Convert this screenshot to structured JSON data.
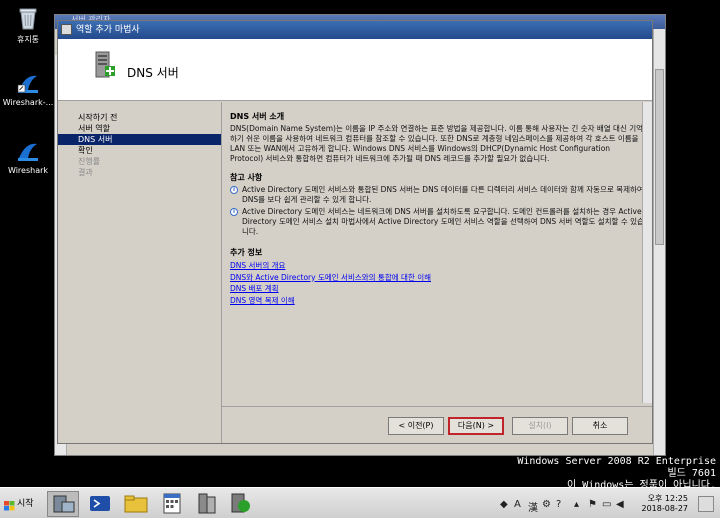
{
  "desktop": {
    "icons": [
      {
        "label": "휴지통"
      },
      {
        "label": "Wireshark-..."
      },
      {
        "label": "Wireshark"
      }
    ],
    "watermark": {
      "line1": "Windows Server 2008 R2 Enterprise",
      "line2": "빌드 7601",
      "line3": "이 Windows는 정품이 아닙니다."
    }
  },
  "background_window": {
    "title": "서버 관리자"
  },
  "wizard": {
    "title": "역할 추가 마법사",
    "header_title": "DNS 서버",
    "nav": [
      {
        "label": "시작하기 전",
        "state": "normal"
      },
      {
        "label": "서버 역할",
        "state": "normal"
      },
      {
        "label": "DNS 서버",
        "state": "selected"
      },
      {
        "label": "확인",
        "state": "normal"
      },
      {
        "label": "진행률",
        "state": "dim"
      },
      {
        "label": "결과",
        "state": "dim"
      }
    ],
    "intro": {
      "title": "DNS 서버 소개",
      "text": "DNS(Domain Name System)는 이름을 IP 주소와 연결하는 표준 방법을 제공합니다. 이름 통해 사용자는 긴 숫자 배열 대신 기억하기 쉬운 이름을 사용하여 네트워크 컴퓨터를 참조할 수 있습니다. 또한 DNS로 계층형 네임스페이스를 제공하여 각 호스트 이름을 LAN 또는 WAN에서 고유하게 합니다. Windows DNS 서비스를 Windows의 DHCP(Dynamic Host Configuration Protocol) 서비스와 통합하면 컴퓨터가 네트워크에 추가될 때 DNS 레코드를 추가할 필요가 없습니다."
    },
    "notes": {
      "title": "참고 사항",
      "items": [
        "Active Directory 도메인 서비스와 통합된 DNS 서버는 DNS 데이터를 다른 디렉터리 서비스 데이터와 함께 자동으로 복제하여 DNS를 보다 쉽게 관리할 수 있게 합니다.",
        "Active Directory 도메인 서비스는 네트워크에 DNS 서버를 설치하도록 요구합니다. 도메인 컨트롤러를 설치하는 경우 Active Directory 도메인 서비스 설치 마법사에서 Active Directory 도메인 서비스 역할을 선택하여 DNS 서버 역할도 설치할 수 있습니다."
      ]
    },
    "more_info": {
      "title": "추가 정보",
      "links": [
        "DNS 서버의 개요",
        "DNS와 Active Directory 도메인 서비스와의 통합에 대한 이해",
        "DNS 배포 계획",
        "DNS 영역 복제 이해"
      ]
    },
    "buttons": {
      "prev": "< 이전(P)",
      "next": "다음(N) >",
      "install": "설치(I)",
      "cancel": "취소"
    }
  },
  "taskbar": {
    "start": "시작",
    "tray_lang": "A",
    "tray_hanja": "漢",
    "clock_time": "오후 12:25",
    "clock_date": "2018-08-27"
  }
}
